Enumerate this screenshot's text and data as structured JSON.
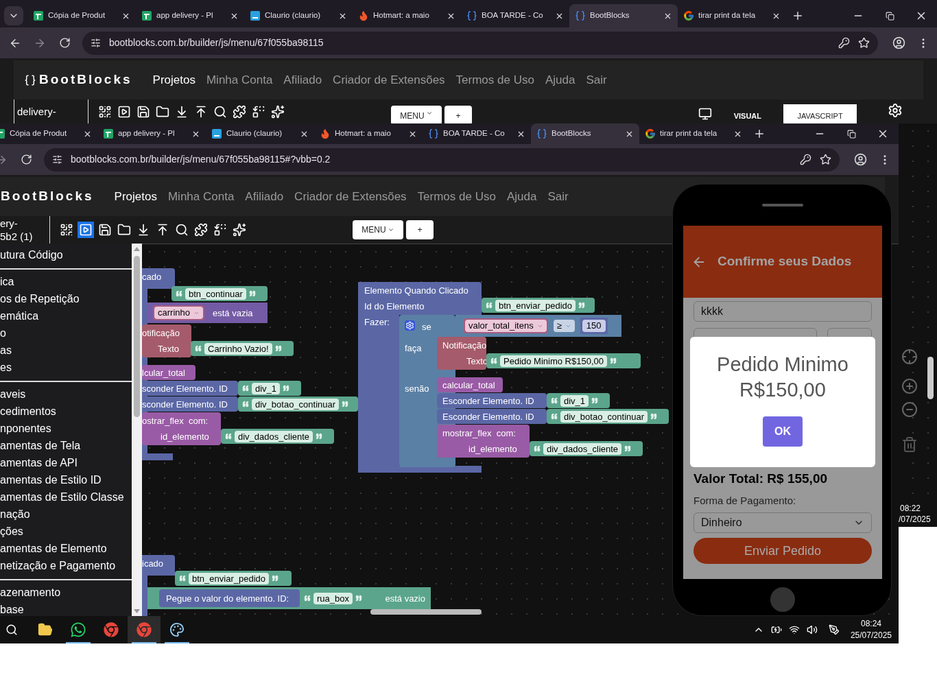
{
  "outer_browser": {
    "tabs": [
      {
        "title": "Cópia de Produt",
        "selected": false
      },
      {
        "title": "app delivery - Pl",
        "selected": false
      },
      {
        "title": "Claurio (claurio)",
        "selected": false
      },
      {
        "title": "Hotmart: a maio",
        "selected": false
      },
      {
        "title": "BOA TARDE - Co",
        "selected": false
      },
      {
        "title": "BootBlocks",
        "selected": true
      },
      {
        "title": "tirar print da tela",
        "selected": false
      }
    ],
    "address": "bootblocks.com.br/builder/js/menu/67f055ba98115",
    "logo": "BootBlocks",
    "nav": [
      {
        "label": "Projetos",
        "selected": true
      },
      {
        "label": "Minha Conta",
        "selected": false
      },
      {
        "label": "Afiliado",
        "selected": false
      },
      {
        "label": "Criador de Extensões",
        "selected": false
      },
      {
        "label": "Termos de Uso",
        "selected": false
      },
      {
        "label": "Ajuda",
        "selected": false
      },
      {
        "label": "Sair",
        "selected": false
      }
    ],
    "project_label": [
      "delivery-"
    ],
    "tools": [
      {
        "selected": false
      },
      {
        "selected": false
      },
      {
        "selected": false
      },
      {
        "selected": false
      },
      {
        "selected": false
      },
      {
        "selected": false
      },
      {
        "selected": false
      },
      {
        "selected": false
      },
      {
        "selected": false
      },
      {
        "selected": false
      }
    ],
    "buttons": [
      "MENU",
      "+"
    ],
    "view_tabs": [
      {
        "label": "VISUAL",
        "selected": true
      },
      {
        "label": "JAVASCRIPT",
        "selected": false
      }
    ],
    "taskbar": {
      "time": "08:22",
      "date": "/07/2025"
    }
  },
  "inner_browser": {
    "tabs": [
      {
        "title": "Cópia de Produt",
        "selected": false
      },
      {
        "title": "app delivery - Pl",
        "selected": false
      },
      {
        "title": "Claurio (claurio)",
        "selected": false
      },
      {
        "title": "Hotmart: a maio",
        "selected": false
      },
      {
        "title": "BOA TARDE - Co",
        "selected": false
      },
      {
        "title": "BootBlocks",
        "selected": true
      },
      {
        "title": "tirar print da tela",
        "selected": false
      }
    ],
    "address": "bootblocks.com.br/builder/js/menu/67f055ba98115#?vbb=0.2",
    "logo": "BootBlocks",
    "nav": [
      {
        "label": "Projetos",
        "selected": true
      },
      {
        "label": "Minha Conta",
        "selected": false
      },
      {
        "label": "Afiliado",
        "selected": false
      },
      {
        "label": "Criador de Extensões",
        "selected": false
      },
      {
        "label": "Termos de Uso",
        "selected": false
      },
      {
        "label": "Ajuda",
        "selected": false
      },
      {
        "label": "Sair",
        "selected": false
      }
    ],
    "project_label": [
      "ery-",
      "5b2 (1)"
    ],
    "tools": [
      {
        "selected": false
      },
      {
        "selected": true
      },
      {
        "selected": false
      },
      {
        "selected": false
      },
      {
        "selected": false
      },
      {
        "selected": false
      },
      {
        "selected": false
      },
      {
        "selected": false
      },
      {
        "selected": false
      },
      {
        "selected": false
      }
    ],
    "buttons": [
      "MENU",
      "+"
    ],
    "sidebar": {
      "sections": [
        [
          "utura Código"
        ],
        [
          "ica",
          "os de Repetição",
          "emática",
          "o",
          "as",
          "es"
        ],
        [
          "aveis",
          "cedimentos",
          "nponentes",
          "amentas de Tela",
          "amentas de API",
          "amentas de Estilo ID",
          "amentas de Estilo Classe",
          "nação",
          "ções",
          "amentas de Elemento",
          "netização e Pagamento"
        ],
        [
          "azenamento",
          "base"
        ]
      ]
    },
    "blocks": [
      {
        "kind": "event",
        "lines": [
          "cado"
        ]
      },
      {
        "kind": "string",
        "value": "btn_continuar"
      },
      {
        "kind": "list",
        "variable": "carrinho",
        "label": "está vazia"
      },
      {
        "kind": "notify",
        "lines": [
          "otificação",
          "Texto"
        ]
      },
      {
        "kind": "string",
        "value": "Carrinho Vazio!"
      },
      {
        "kind": "proc",
        "lines": [
          "lcular_total"
        ]
      },
      {
        "kind": "element",
        "lines": [
          "sconder Elemento. ID"
        ]
      },
      {
        "kind": "string",
        "value": "div_1"
      },
      {
        "kind": "element",
        "lines": [
          "sconder Elemento. ID"
        ]
      },
      {
        "kind": "string",
        "value": "div_botao_continuar"
      },
      {
        "kind": "proc",
        "lines": [
          "ostrar_flex  com:",
          "id_elemento"
        ]
      },
      {
        "kind": "string",
        "value": "div_dados_cliente"
      },
      {
        "kind": "event",
        "lines": [
          "Elemento Quando Clicado",
          "Id do Elemento",
          "Fazer:"
        ]
      },
      {
        "kind": "string",
        "value": "btn_enviar_pedido"
      },
      {
        "kind": "if",
        "lines": [
          "se",
          "faça",
          "senão"
        ]
      },
      {
        "kind": "compare",
        "variable": "valor_total_itens",
        "operator": "≥",
        "number": "150"
      },
      {
        "kind": "notify",
        "lines": [
          "Notificação",
          "Texto"
        ]
      },
      {
        "kind": "string",
        "value": "Pedido Minimo R$150,00"
      },
      {
        "kind": "proc",
        "lines": [
          "calcular_total"
        ]
      },
      {
        "kind": "element",
        "lines": [
          "Esconder Elemento. ID"
        ]
      },
      {
        "kind": "string",
        "value": "div_1"
      },
      {
        "kind": "element",
        "lines": [
          "Esconder Elemento. ID"
        ]
      },
      {
        "kind": "string",
        "value": "div_botao_continuar"
      },
      {
        "kind": "proc",
        "lines": [
          "mostrar_flex  com:",
          "id_elemento"
        ]
      },
      {
        "kind": "string",
        "value": "div_dados_cliente"
      },
      {
        "kind": "event",
        "lines": [
          "icado"
        ]
      },
      {
        "kind": "string",
        "value": "btn_enviar_pedido"
      },
      {
        "kind": "get_value",
        "lines": [
          "Pegue o valor do elemento. ID:"
        ]
      },
      {
        "kind": "string",
        "value": "rua_box"
      },
      {
        "kind": "empty_check",
        "label": "está vazio"
      }
    ],
    "phone": {
      "title": "Confirme seus Dados",
      "name_field": "kkkk",
      "modal": {
        "message": "Pedido Minimo R$150,00",
        "button": "OK"
      },
      "total": "Valor Total: R$ 155,00",
      "payment_label": "Forma de Pagamento:",
      "payment": "Dinheiro",
      "submit": "Enviar Pedido"
    },
    "taskbar": {
      "apps": [
        {
          "open": false,
          "selected": false
        },
        {
          "open": true,
          "selected": false
        },
        {
          "open": false,
          "selected": false
        },
        {
          "open": true,
          "selected": true
        },
        {
          "open": true,
          "selected": false
        }
      ],
      "time": "08:24",
      "date": "25/07/2025"
    }
  }
}
